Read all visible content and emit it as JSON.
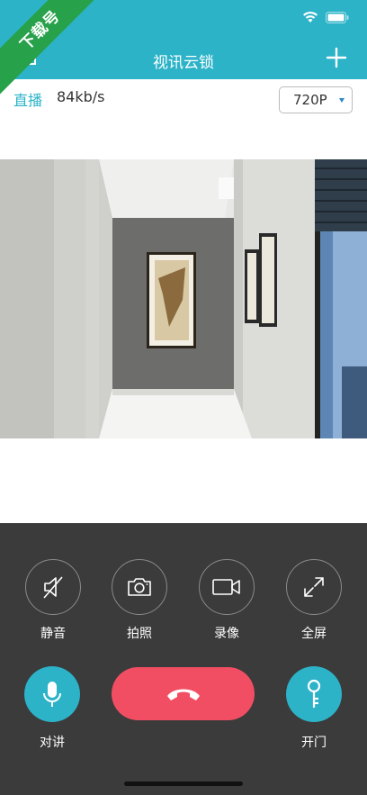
{
  "header": {
    "title": "视讯云锁",
    "add_icon": "plus-icon",
    "back_icon": "back-icon",
    "color": "#2cb3c8"
  },
  "watermark": {
    "text": "下载号"
  },
  "info": {
    "live_label": "直播",
    "bitrate": "84kb/s",
    "resolution": "720P"
  },
  "controls": [
    {
      "label": "静音",
      "icon": "mute-icon"
    },
    {
      "label": "拍照",
      "icon": "camera-icon"
    },
    {
      "label": "录像",
      "icon": "video-record-icon"
    },
    {
      "label": "全屏",
      "icon": "fullscreen-icon"
    }
  ],
  "actions": {
    "talk_label": "对讲",
    "unlock_label": "开门",
    "hangup_icon": "hang-up-icon",
    "talk_color": "#2cb3c8",
    "hangup_color": "#f24e63"
  }
}
